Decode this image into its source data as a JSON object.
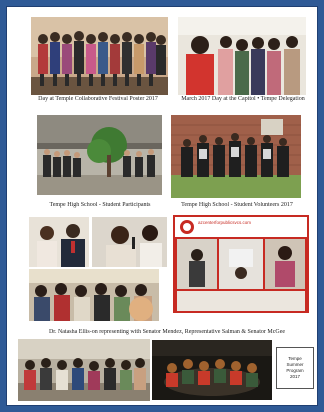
{
  "captions": {
    "photo1": "Day at Temple Collaborative Festival Poster 2017",
    "photo2": "March 2017 Day at the Capitol • Tempe Delegation",
    "photo3": "Tempe High School - Student Participants",
    "photo4": "Tempe High School - Student Volunteers 2017",
    "photo6": "Dr. Natasha Ellis-on representing with Senator Mendez, Representative Salman & Senator McGee"
  },
  "logo_text": "azcenterforpublicsvcs.com",
  "program_box": {
    "line1": "Tempe",
    "line2": "Summer",
    "line3": "Program",
    "line4": "2017"
  }
}
